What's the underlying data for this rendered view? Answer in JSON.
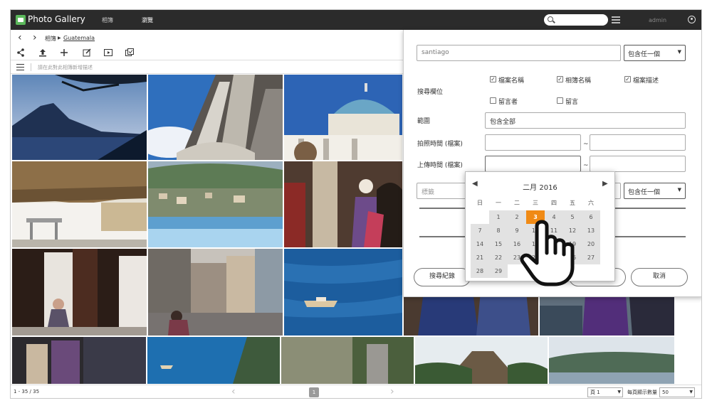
{
  "app": {
    "title": "Photo Gallery"
  },
  "topnav": {
    "items": [
      "相簿",
      "瀏覽"
    ]
  },
  "search": {
    "placeholder": ""
  },
  "user": {
    "name": "admin"
  },
  "breadcrumb": {
    "root": "相簿",
    "current": "Guatemala"
  },
  "addbar": {
    "text": "請在此對此相簿新增描述"
  },
  "status": {
    "range": "1 - 35 / 35",
    "page": "1",
    "page_select": "頁 1",
    "per_page_label": "每頁顯示數量",
    "per_page": "50"
  },
  "panel": {
    "keyword_value": "santiago",
    "match_mode": "包含任一個",
    "search_fields_label": "搜尋欄位",
    "checkboxes": [
      {
        "label": "檔案名稱",
        "checked": true
      },
      {
        "label": "相簿名稱",
        "checked": true
      },
      {
        "label": "檔案描述",
        "checked": true
      },
      {
        "label": "留言者",
        "checked": false
      },
      {
        "label": "留言",
        "checked": false
      }
    ],
    "scope_label": "範圍",
    "scope_value": "包含全部",
    "shot_time_label": "拍照時間 (檔案)",
    "upload_time_label": "上傳時間 (檔案)",
    "range_sep": "~",
    "tag_placeholder": "標籤",
    "tag_match_mode": "包含任一個",
    "history_button": "搜尋紀錄",
    "cancel_button": "取消"
  },
  "calendar": {
    "month_label": "二月 2016",
    "weekdays": [
      "日",
      "一",
      "二",
      "三",
      "四",
      "五",
      "六"
    ],
    "today": "3",
    "rows": [
      [
        "",
        "1",
        "2",
        "3",
        "4",
        "5",
        "6"
      ],
      [
        "7",
        "8",
        "9",
        "10",
        "11",
        "12",
        "13"
      ],
      [
        "14",
        "15",
        "16",
        "17",
        "18",
        "19",
        "20"
      ],
      [
        "21",
        "22",
        "23",
        "24",
        "25",
        "26",
        "27"
      ],
      [
        "28",
        "29",
        "",
        "",
        "",
        "",
        ""
      ]
    ]
  },
  "colors": {
    "topbar": "#2b2b2b",
    "accent": "#f08a15",
    "logo": "#5cb85c"
  }
}
